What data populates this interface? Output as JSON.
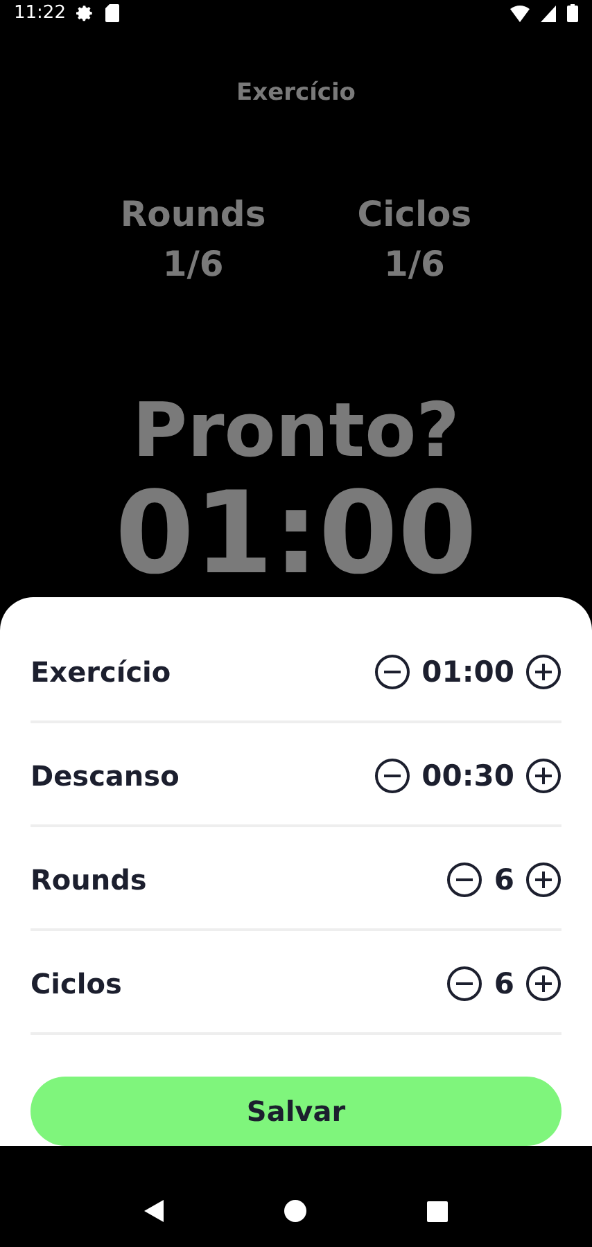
{
  "status_bar": {
    "time": "11:22"
  },
  "header": {
    "title": "Exercício"
  },
  "counters": [
    {
      "label": "Rounds",
      "value": "1/6"
    },
    {
      "label": "Ciclos",
      "value": "1/6"
    }
  ],
  "prompt": "Pronto?",
  "timer": "01:00",
  "settings": [
    {
      "label": "Exercício",
      "value": "01:00"
    },
    {
      "label": "Descanso",
      "value": "00:30"
    },
    {
      "label": "Rounds",
      "value": "6"
    },
    {
      "label": "Ciclos",
      "value": "6"
    }
  ],
  "save_button": "Salvar"
}
